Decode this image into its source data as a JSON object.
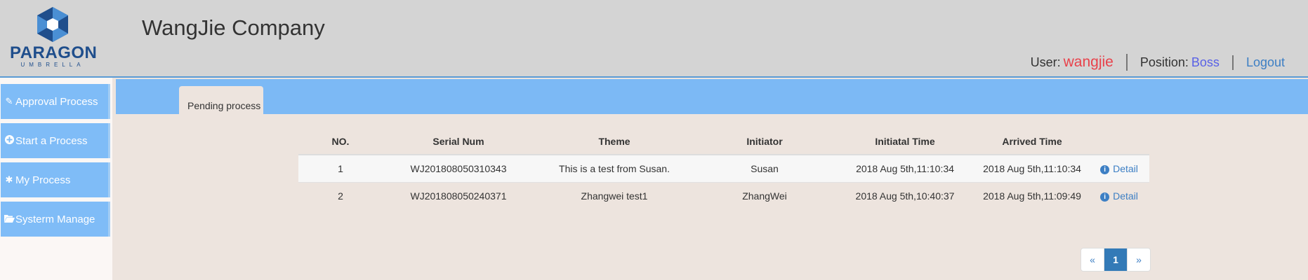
{
  "logo": {
    "word": "PARAGON",
    "sub": "UMBRELLA"
  },
  "header": {
    "company": "WangJie Company",
    "user_label": "User:",
    "user_name": "wangjie",
    "position_label": "Position:",
    "position_value": "Boss",
    "logout": "Logout"
  },
  "sidebar": {
    "items": [
      {
        "label": "Approval Process",
        "icon": "pencil-icon"
      },
      {
        "label": "Start a Process",
        "icon": "plus-circle-icon"
      },
      {
        "label": "My Process",
        "icon": "asterisk-icon"
      },
      {
        "label": "Systerm Manage",
        "icon": "folder-open-icon"
      }
    ]
  },
  "tabs": [
    {
      "label": "Pending process",
      "active": true
    }
  ],
  "table": {
    "columns": [
      "NO.",
      "Serial Num",
      "Theme",
      "Initiator",
      "Initiatal Time",
      "Arrived Time",
      ""
    ],
    "rows": [
      {
        "no": "1",
        "serial": "WJ201808050310343",
        "theme": "This is a test from Susan.",
        "initiator": "Susan",
        "initiatal_time": "2018 Aug 5th,11:10:34",
        "arrived_time": "2018 Aug 5th,11:10:34",
        "action": "Detail"
      },
      {
        "no": "2",
        "serial": "WJ201808050240371",
        "theme": "Zhangwei test1",
        "initiator": "ZhangWei",
        "initiatal_time": "2018 Aug 5th,10:40:37",
        "arrived_time": "2018 Aug 5th,11:09:49",
        "action": "Detail"
      }
    ]
  },
  "pager": {
    "prev": "«",
    "current": "1",
    "next": "»"
  },
  "colors": {
    "accent": "#7cb9f5",
    "username": "#e8424b",
    "position": "#5a62e6",
    "link": "#3d7fc4"
  }
}
